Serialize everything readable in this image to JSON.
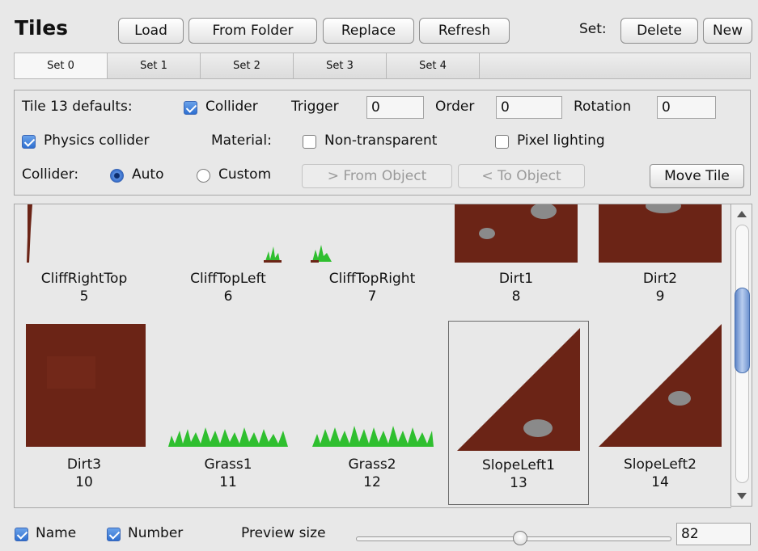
{
  "header": {
    "title": "Tiles",
    "buttons": {
      "load": "Load",
      "from_folder": "From Folder",
      "replace": "Replace",
      "refresh": "Refresh"
    },
    "set_label": "Set:",
    "set_buttons": {
      "delete": "Delete",
      "new": "New"
    }
  },
  "tabs": [
    "Set 0",
    "Set 1",
    "Set 2",
    "Set 3",
    "Set 4"
  ],
  "active_tab": "Set 0",
  "defaults": {
    "label": "Tile 13 defaults:",
    "collider_label": "Collider",
    "collider_checked": true,
    "trigger_label": "Trigger",
    "trigger_value": "0",
    "order_label": "Order",
    "order_value": "0",
    "rotation_label": "Rotation",
    "rotation_value": "0",
    "physics_collider_label": "Physics collider",
    "physics_collider_checked": true,
    "material_label": "Material:",
    "non_transparent_label": "Non-transparent",
    "non_transparent_checked": false,
    "pixel_lighting_label": "Pixel lighting",
    "pixel_lighting_checked": false,
    "collider_mode_label": "Collider:",
    "auto_label": "Auto",
    "custom_label": "Custom",
    "selected_mode": "Auto",
    "from_object": "> From Object",
    "to_object": "< To Object",
    "move_tile": "Move Tile"
  },
  "tiles": [
    {
      "name": "CliffRightTop",
      "number": "5"
    },
    {
      "name": "CliffTopLeft",
      "number": "6"
    },
    {
      "name": "CliffTopRight",
      "number": "7"
    },
    {
      "name": "Dirt1",
      "number": "8"
    },
    {
      "name": "Dirt2",
      "number": "9"
    },
    {
      "name": "Dirt3",
      "number": "10"
    },
    {
      "name": "Grass1",
      "number": "11"
    },
    {
      "name": "Grass2",
      "number": "12"
    },
    {
      "name": "SlopeLeft1",
      "number": "13"
    },
    {
      "name": "SlopeLeft2",
      "number": "14"
    }
  ],
  "selected_tile": "13",
  "footer": {
    "name_label": "Name",
    "name_checked": true,
    "number_label": "Number",
    "number_checked": true,
    "preview_label": "Preview size",
    "preview_value": "82"
  },
  "colors": {
    "dirt": "#6b2416",
    "rock": "#8a8a8a",
    "grass": "#2fbf2f",
    "accent": "#2f6fd0"
  }
}
